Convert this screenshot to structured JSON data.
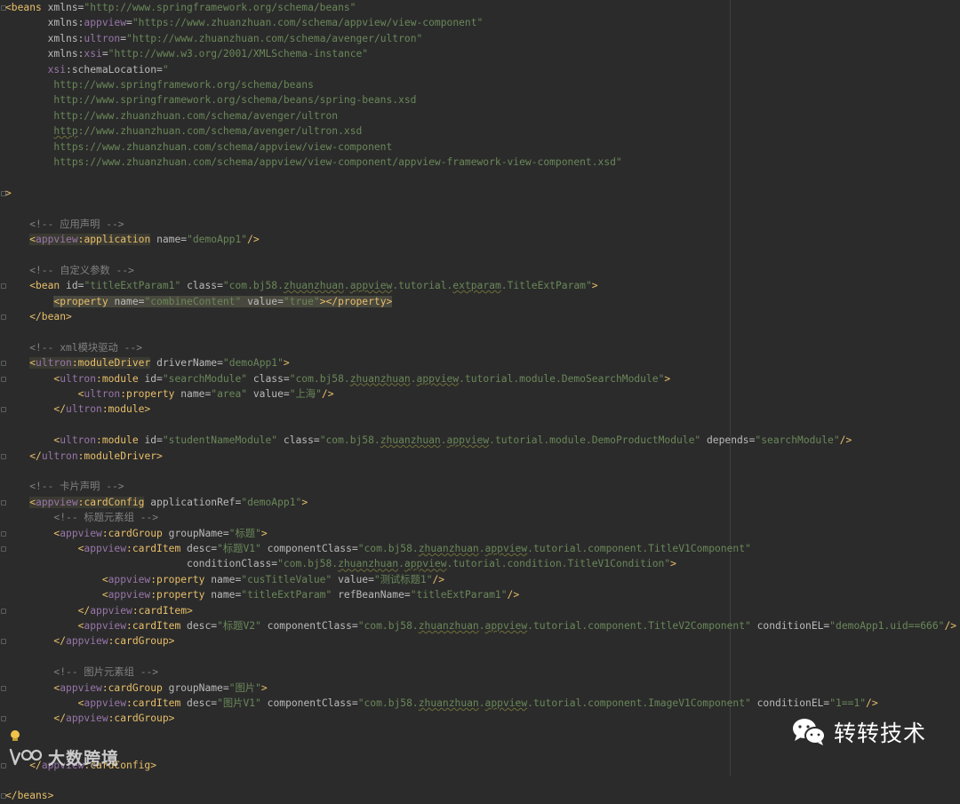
{
  "editor": {
    "lines": [
      [
        {
          "t": "<beans",
          "c": "tag"
        },
        {
          "t": " xmlns=",
          "c": "attr"
        },
        {
          "t": "\"http://www.springframework.org/schema/beans\"",
          "c": "val"
        }
      ],
      [
        {
          "t": "       xmlns:",
          "c": "attr"
        },
        {
          "t": "appview",
          "c": "ns"
        },
        {
          "t": "=",
          "c": "attr"
        },
        {
          "t": "\"https://www.zhuanzhuan.com/schema/appview/view-component\"",
          "c": "val"
        }
      ],
      [
        {
          "t": "       xmlns:",
          "c": "attr"
        },
        {
          "t": "ultron",
          "c": "ns"
        },
        {
          "t": "=",
          "c": "attr"
        },
        {
          "t": "\"http://www.zhuanzhuan.com/schema/avenger/ultron\"",
          "c": "val"
        }
      ],
      [
        {
          "t": "       xmlns:",
          "c": "attr"
        },
        {
          "t": "xsi",
          "c": "ns"
        },
        {
          "t": "=",
          "c": "attr"
        },
        {
          "t": "\"http://www.w3.org/2001/XMLSchema-instance\"",
          "c": "val"
        }
      ],
      [
        {
          "t": "       ",
          "c": "attr"
        },
        {
          "t": "xsi",
          "c": "ns"
        },
        {
          "t": ":schemaLocation=",
          "c": "attr"
        },
        {
          "t": "\"",
          "c": "val"
        }
      ],
      [
        {
          "t": "        http://www.springframework.org/schema/beans",
          "c": "val"
        }
      ],
      [
        {
          "t": "        http://www.springframework.org/schema/beans/spring-beans.xsd",
          "c": "val"
        }
      ],
      [
        {
          "t": "        http://www.zhuanzhuan.com/schema/avenger/ultron",
          "c": "val"
        }
      ],
      [
        {
          "t": "        ",
          "c": "val"
        },
        {
          "t": "http",
          "c": "val squig"
        },
        {
          "t": "://www.zhuanzhuan.com/schema/avenger/ultron.xsd",
          "c": "val"
        }
      ],
      [
        {
          "t": "        https://www.zhuanzhuan.com/schema/appview/view-component",
          "c": "val"
        }
      ],
      [
        {
          "t": "        https://www.zhuanzhuan.com/schema/appview/view-component/appview-framework-view-component.xsd\"",
          "c": "val"
        }
      ],
      [],
      [
        {
          "t": ">",
          "c": "tag"
        }
      ],
      [],
      [
        {
          "t": "    <!-- 应用声明 -->",
          "c": "cmt"
        }
      ],
      [
        {
          "t": "    ",
          "c": "plain"
        },
        {
          "t": "<",
          "c": "tag hl"
        },
        {
          "t": "appview",
          "c": "ns hl"
        },
        {
          "t": ":application",
          "c": "tag hl"
        },
        {
          "t": " name=",
          "c": "attr"
        },
        {
          "t": "\"demoApp1\"",
          "c": "val"
        },
        {
          "t": "/>",
          "c": "tag"
        }
      ],
      [],
      [
        {
          "t": "    <!-- 自定义参数 -->",
          "c": "cmt"
        }
      ],
      [
        {
          "t": "    <bean",
          "c": "tag"
        },
        {
          "t": " id=",
          "c": "attr"
        },
        {
          "t": "\"titleExtParam1\"",
          "c": "val"
        },
        {
          "t": " class=",
          "c": "attr"
        },
        {
          "t": "\"com.bj58.",
          "c": "val"
        },
        {
          "t": "zhuanzhuan",
          "c": "val squig"
        },
        {
          "t": ".",
          "c": "val"
        },
        {
          "t": "appview",
          "c": "val squig"
        },
        {
          "t": ".tutorial.",
          "c": "val"
        },
        {
          "t": "extparam",
          "c": "val squig"
        },
        {
          "t": ".TitleExtParam\"",
          "c": "val"
        },
        {
          "t": ">",
          "c": "tag"
        }
      ],
      [
        {
          "t": "        ",
          "c": "plain"
        },
        {
          "t": "<property",
          "c": "tag hl2"
        },
        {
          "t": " name=",
          "c": "attr hl2"
        },
        {
          "t": "\"combineContent\"",
          "c": "val hl2"
        },
        {
          "t": " value=",
          "c": "attr hl2"
        },
        {
          "t": "\"true\"",
          "c": "val hl2"
        },
        {
          "t": "></property>",
          "c": "tag hl2"
        }
      ],
      [
        {
          "t": "    </bean>",
          "c": "tag"
        }
      ],
      [],
      [
        {
          "t": "    <!-- xml模块驱动 -->",
          "c": "cmt"
        }
      ],
      [
        {
          "t": "    ",
          "c": "plain"
        },
        {
          "t": "<",
          "c": "tag hl"
        },
        {
          "t": "ultron",
          "c": "ns hl"
        },
        {
          "t": ":moduleDriver",
          "c": "tag hl"
        },
        {
          "t": " driverName=",
          "c": "attr"
        },
        {
          "t": "\"demoApp1\"",
          "c": "val"
        },
        {
          "t": ">",
          "c": "tag"
        }
      ],
      [
        {
          "t": "        <",
          "c": "tag"
        },
        {
          "t": "ultron",
          "c": "ns"
        },
        {
          "t": ":module",
          "c": "tag"
        },
        {
          "t": " id=",
          "c": "attr"
        },
        {
          "t": "\"searchModule\"",
          "c": "val"
        },
        {
          "t": " class=",
          "c": "attr"
        },
        {
          "t": "\"com.bj58.",
          "c": "val"
        },
        {
          "t": "zhuanzhuan",
          "c": "val squig"
        },
        {
          "t": ".",
          "c": "val"
        },
        {
          "t": "appview",
          "c": "val squig"
        },
        {
          "t": ".tutorial.module.DemoSearchModule\"",
          "c": "val"
        },
        {
          "t": ">",
          "c": "tag"
        }
      ],
      [
        {
          "t": "            <",
          "c": "tag"
        },
        {
          "t": "ultron",
          "c": "ns"
        },
        {
          "t": ":property",
          "c": "tag"
        },
        {
          "t": " name=",
          "c": "attr"
        },
        {
          "t": "\"area\"",
          "c": "val"
        },
        {
          "t": " value=",
          "c": "attr"
        },
        {
          "t": "\"上海\"",
          "c": "val"
        },
        {
          "t": "/>",
          "c": "tag"
        }
      ],
      [
        {
          "t": "        </",
          "c": "tag"
        },
        {
          "t": "ultron",
          "c": "ns"
        },
        {
          "t": ":module>",
          "c": "tag"
        }
      ],
      [],
      [
        {
          "t": "        <",
          "c": "tag"
        },
        {
          "t": "ultron",
          "c": "ns"
        },
        {
          "t": ":module",
          "c": "tag"
        },
        {
          "t": " id=",
          "c": "attr"
        },
        {
          "t": "\"studentNameModule\"",
          "c": "val"
        },
        {
          "t": " class=",
          "c": "attr"
        },
        {
          "t": "\"com.bj58.",
          "c": "val"
        },
        {
          "t": "zhuanzhuan",
          "c": "val squig"
        },
        {
          "t": ".",
          "c": "val"
        },
        {
          "t": "appview",
          "c": "val squig"
        },
        {
          "t": ".tutorial.module.DemoProductModule\"",
          "c": "val"
        },
        {
          "t": " depends=",
          "c": "attr"
        },
        {
          "t": "\"searchModule\"",
          "c": "val"
        },
        {
          "t": "/>",
          "c": "tag"
        }
      ],
      [
        {
          "t": "    </",
          "c": "tag"
        },
        {
          "t": "ultron",
          "c": "ns"
        },
        {
          "t": ":moduleDriver>",
          "c": "tag"
        }
      ],
      [],
      [
        {
          "t": "    <!-- 卡片声明 -->",
          "c": "cmt"
        }
      ],
      [
        {
          "t": "    ",
          "c": "plain"
        },
        {
          "t": "<",
          "c": "tag hl"
        },
        {
          "t": "appview",
          "c": "ns hl"
        },
        {
          "t": ":cardConfig",
          "c": "tag hl"
        },
        {
          "t": " applicationRef=",
          "c": "attr"
        },
        {
          "t": "\"demoApp1\"",
          "c": "val"
        },
        {
          "t": ">",
          "c": "tag"
        }
      ],
      [
        {
          "t": "        <!-- 标题元素组 -->",
          "c": "cmt"
        }
      ],
      [
        {
          "t": "        <",
          "c": "tag"
        },
        {
          "t": "appview",
          "c": "ns"
        },
        {
          "t": ":cardGroup",
          "c": "tag"
        },
        {
          "t": " groupName=",
          "c": "attr"
        },
        {
          "t": "\"标题\"",
          "c": "val"
        },
        {
          "t": ">",
          "c": "tag"
        }
      ],
      [
        {
          "t": "            <",
          "c": "tag"
        },
        {
          "t": "appview",
          "c": "ns"
        },
        {
          "t": ":cardItem",
          "c": "tag"
        },
        {
          "t": " desc=",
          "c": "attr"
        },
        {
          "t": "\"标题V1\"",
          "c": "val"
        },
        {
          "t": " componentClass=",
          "c": "attr"
        },
        {
          "t": "\"com.bj58.",
          "c": "val"
        },
        {
          "t": "zhuanzhuan",
          "c": "val squig"
        },
        {
          "t": ".",
          "c": "val"
        },
        {
          "t": "appview",
          "c": "val squig"
        },
        {
          "t": ".tutorial.component.TitleV1Component\"",
          "c": "val"
        }
      ],
      [
        {
          "t": "                              conditionClass=",
          "c": "attr"
        },
        {
          "t": "\"com.bj58.",
          "c": "val"
        },
        {
          "t": "zhuanzhuan",
          "c": "val squig"
        },
        {
          "t": ".",
          "c": "val"
        },
        {
          "t": "appview",
          "c": "val squig"
        },
        {
          "t": ".tutorial.condition.TitleV1Condition\"",
          "c": "val"
        },
        {
          "t": ">",
          "c": "tag"
        }
      ],
      [
        {
          "t": "                <",
          "c": "tag"
        },
        {
          "t": "appview",
          "c": "ns"
        },
        {
          "t": ":property",
          "c": "tag"
        },
        {
          "t": " name=",
          "c": "attr"
        },
        {
          "t": "\"cusTitleValue\"",
          "c": "val"
        },
        {
          "t": " value=",
          "c": "attr"
        },
        {
          "t": "\"测试标题1\"",
          "c": "val"
        },
        {
          "t": "/>",
          "c": "tag"
        }
      ],
      [
        {
          "t": "                <",
          "c": "tag"
        },
        {
          "t": "appview",
          "c": "ns"
        },
        {
          "t": ":property",
          "c": "tag"
        },
        {
          "t": " name=",
          "c": "attr"
        },
        {
          "t": "\"titleExtParam\"",
          "c": "val"
        },
        {
          "t": " refBeanName=",
          "c": "attr"
        },
        {
          "t": "\"titleExtParam1\"",
          "c": "val"
        },
        {
          "t": "/>",
          "c": "tag"
        }
      ],
      [
        {
          "t": "            </",
          "c": "tag"
        },
        {
          "t": "appview",
          "c": "ns"
        },
        {
          "t": ":cardItem>",
          "c": "tag"
        }
      ],
      [
        {
          "t": "            <",
          "c": "tag"
        },
        {
          "t": "appview",
          "c": "ns"
        },
        {
          "t": ":cardItem",
          "c": "tag"
        },
        {
          "t": " desc=",
          "c": "attr"
        },
        {
          "t": "\"标题V2\"",
          "c": "val"
        },
        {
          "t": " componentClass=",
          "c": "attr"
        },
        {
          "t": "\"com.bj58.",
          "c": "val"
        },
        {
          "t": "zhuanzhuan",
          "c": "val squig"
        },
        {
          "t": ".",
          "c": "val"
        },
        {
          "t": "appview",
          "c": "val squig"
        },
        {
          "t": ".tutorial.component.TitleV2Component\"",
          "c": "val"
        },
        {
          "t": " conditionEL=",
          "c": "attr"
        },
        {
          "t": "\"demoApp1.uid==666\"",
          "c": "val"
        },
        {
          "t": "/>",
          "c": "tag"
        }
      ],
      [
        {
          "t": "        </",
          "c": "tag"
        },
        {
          "t": "appview",
          "c": "ns"
        },
        {
          "t": ":cardGroup>",
          "c": "tag"
        }
      ],
      [],
      [
        {
          "t": "        <!-- 图片元素组 -->",
          "c": "cmt"
        }
      ],
      [
        {
          "t": "        <",
          "c": "tag"
        },
        {
          "t": "appview",
          "c": "ns"
        },
        {
          "t": ":cardGroup",
          "c": "tag"
        },
        {
          "t": " groupName=",
          "c": "attr"
        },
        {
          "t": "\"图片\"",
          "c": "val"
        },
        {
          "t": ">",
          "c": "tag"
        }
      ],
      [
        {
          "t": "            <",
          "c": "tag"
        },
        {
          "t": "appview",
          "c": "ns"
        },
        {
          "t": ":cardItem",
          "c": "tag"
        },
        {
          "t": " desc=",
          "c": "attr"
        },
        {
          "t": "\"图片V1\"",
          "c": "val"
        },
        {
          "t": " componentClass=",
          "c": "attr"
        },
        {
          "t": "\"com.bj58.",
          "c": "val"
        },
        {
          "t": "zhuanzhuan",
          "c": "val squig"
        },
        {
          "t": ".",
          "c": "val"
        },
        {
          "t": "appview",
          "c": "val squig"
        },
        {
          "t": ".tutorial.component.ImageV1Component\"",
          "c": "val"
        },
        {
          "t": " conditionEL=",
          "c": "attr"
        },
        {
          "t": "\"1==1\"",
          "c": "val"
        },
        {
          "t": "/>",
          "c": "tag"
        }
      ],
      [
        {
          "t": "        </",
          "c": "tag"
        },
        {
          "t": "appview",
          "c": "ns"
        },
        {
          "t": ":cardGroup>",
          "c": "tag"
        }
      ],
      [],
      [],
      [
        {
          "t": "    </",
          "c": "tag"
        },
        {
          "t": "appview",
          "c": "ns"
        },
        {
          "t": ":cardConfig>",
          "c": "tag"
        }
      ],
      [],
      [
        {
          "t": "</beans>",
          "c": "tag"
        }
      ]
    ],
    "colors": {
      "background": "#2b2b2b",
      "tag": "#e8bf6a",
      "namespace": "#9876aa",
      "attribute": "#bababa",
      "value": "#6a8759",
      "comment": "#808080"
    }
  },
  "watermarks": {
    "left_text": "大数跨境",
    "right_text": "转转技术",
    "left_icon": "brand-logo-icon",
    "right_icon": "wechat-icon",
    "intention_icon": "lightbulb-icon"
  }
}
